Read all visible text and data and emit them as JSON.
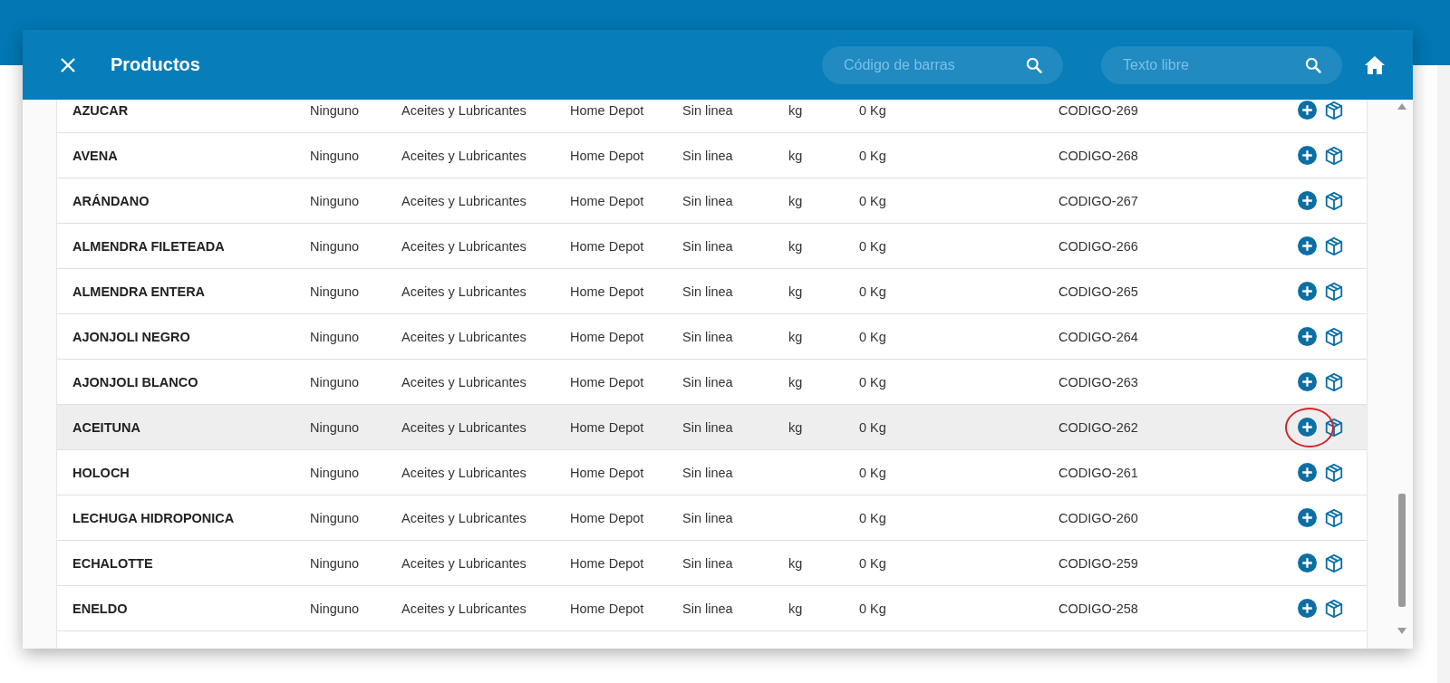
{
  "modal": {
    "title": "Productos",
    "barcode_search": {
      "placeholder": "Código de barras"
    },
    "text_search": {
      "placeholder": "Texto libre"
    }
  },
  "table": {
    "rows": [
      {
        "name": "AZUCAR",
        "column_2": "Ninguno",
        "column_3": "Aceites y Lubricantes",
        "column_4": "Home Depot",
        "column_5": "Sin linea",
        "unit": "kg",
        "stock": "0 Kg",
        "code": "CODIGO-269",
        "selected": false,
        "circled": false
      },
      {
        "name": "AVENA",
        "column_2": "Ninguno",
        "column_3": "Aceites y Lubricantes",
        "column_4": "Home Depot",
        "column_5": "Sin linea",
        "unit": "kg",
        "stock": "0 Kg",
        "code": "CODIGO-268",
        "selected": false,
        "circled": false
      },
      {
        "name": "ARÁNDANO",
        "column_2": "Ninguno",
        "column_3": "Aceites y Lubricantes",
        "column_4": "Home Depot",
        "column_5": "Sin linea",
        "unit": "kg",
        "stock": "0 Kg",
        "code": "CODIGO-267",
        "selected": false,
        "circled": false
      },
      {
        "name": "ALMENDRA FILETEADA",
        "column_2": "Ninguno",
        "column_3": "Aceites y Lubricantes",
        "column_4": "Home Depot",
        "column_5": "Sin linea",
        "unit": "kg",
        "stock": "0 Kg",
        "code": "CODIGO-266",
        "selected": false,
        "circled": false
      },
      {
        "name": "ALMENDRA ENTERA",
        "column_2": "Ninguno",
        "column_3": "Aceites y Lubricantes",
        "column_4": "Home Depot",
        "column_5": "Sin linea",
        "unit": "kg",
        "stock": "0 Kg",
        "code": "CODIGO-265",
        "selected": false,
        "circled": false
      },
      {
        "name": "AJONJOLI NEGRO",
        "column_2": "Ninguno",
        "column_3": "Aceites y Lubricantes",
        "column_4": "Home Depot",
        "column_5": "Sin linea",
        "unit": "kg",
        "stock": "0 Kg",
        "code": "CODIGO-264",
        "selected": false,
        "circled": false
      },
      {
        "name": "AJONJOLI BLANCO",
        "column_2": "Ninguno",
        "column_3": "Aceites y Lubricantes",
        "column_4": "Home Depot",
        "column_5": "Sin linea",
        "unit": "kg",
        "stock": "0 Kg",
        "code": "CODIGO-263",
        "selected": false,
        "circled": false
      },
      {
        "name": "ACEITUNA",
        "column_2": "Ninguno",
        "column_3": "Aceites y Lubricantes",
        "column_4": "Home Depot",
        "column_5": "Sin linea",
        "unit": "kg",
        "stock": "0 Kg",
        "code": "CODIGO-262",
        "selected": true,
        "circled": true
      },
      {
        "name": "HOLOCH",
        "column_2": "Ninguno",
        "column_3": "Aceites y Lubricantes",
        "column_4": "Home Depot",
        "column_5": "Sin linea",
        "stock": "0 Kg",
        "code": "CODIGO-261",
        "selected": false,
        "circled": false
      },
      {
        "name": "LECHUGA HIDROPONICA",
        "column_2": "Ninguno",
        "column_3": "Aceites y Lubricantes",
        "column_4": "Home Depot",
        "column_5": "Sin linea",
        "stock": "0 Kg",
        "code": "CODIGO-260",
        "selected": false,
        "circled": false
      },
      {
        "name": "ECHALOTTE",
        "column_2": "Ninguno",
        "column_3": "Aceites y Lubricantes",
        "column_4": "Home Depot",
        "column_5": "Sin linea",
        "unit": "kg",
        "stock": "0 Kg",
        "code": "CODIGO-259",
        "selected": false,
        "circled": false
      },
      {
        "name": "ENELDO",
        "column_2": "Ninguno",
        "column_3": "Aceites y Lubricantes",
        "column_4": "Home Depot",
        "column_5": "Sin linea",
        "unit": "kg",
        "stock": "0 Kg",
        "code": "CODIGO-258",
        "selected": false,
        "circled": false
      }
    ]
  }
}
